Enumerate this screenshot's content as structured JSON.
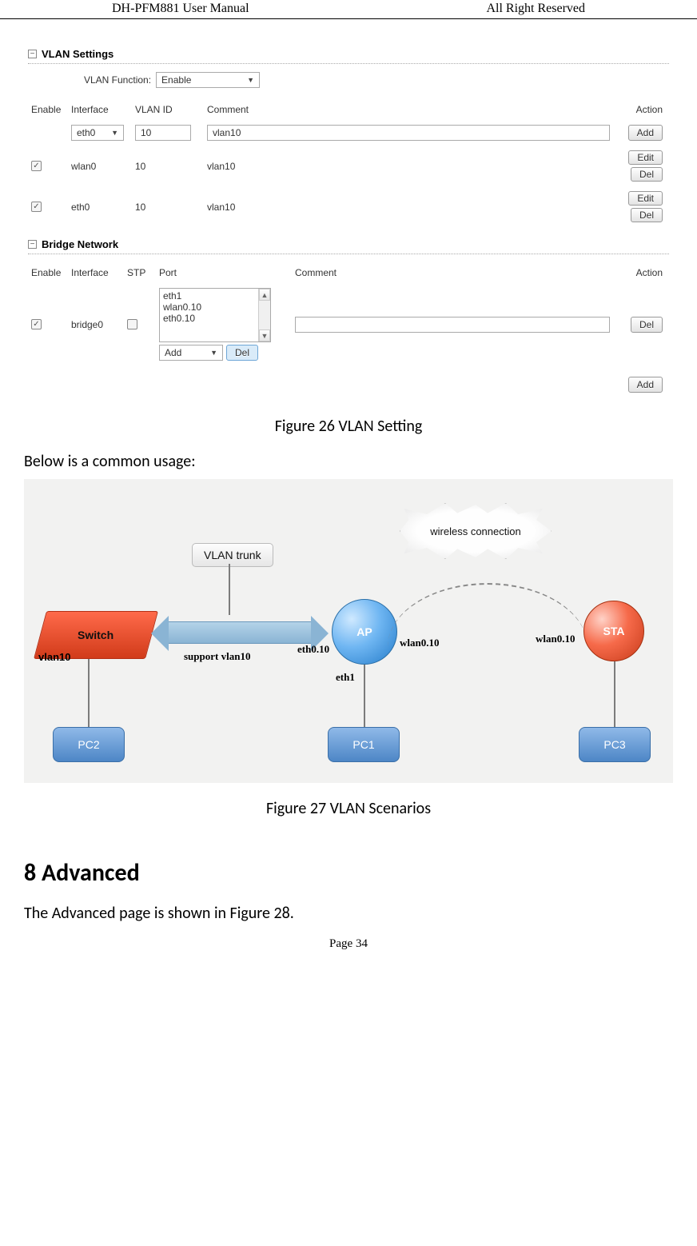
{
  "header": {
    "left": "DH-PFM881 User Manual",
    "right": "All Right Reserved"
  },
  "footer": {
    "page": "Page 34"
  },
  "captions": {
    "fig26": "Figure 26 VLAN Setting",
    "fig27": "Figure 27 VLAN Scenarios"
  },
  "body": {
    "usage_intro": "Below is a common usage:",
    "section_title": "8  Advanced",
    "section_text": "The Advanced page is shown in Figure 28."
  },
  "vlan_settings": {
    "section_title": "VLAN Settings",
    "function_label": "VLAN Function:",
    "function_value": "Enable",
    "columns": {
      "enable": "Enable",
      "interface": "Interface",
      "vlan_id": "VLAN ID",
      "comment": "Comment",
      "action": "Action"
    },
    "new_row": {
      "interface": "eth0",
      "vlan_id": "10",
      "comment": "vlan10",
      "add": "Add"
    },
    "rows": [
      {
        "interface": "wlan0",
        "vlan_id": "10",
        "comment": "vlan10",
        "edit": "Edit",
        "del": "Del"
      },
      {
        "interface": "eth0",
        "vlan_id": "10",
        "comment": "vlan10",
        "edit": "Edit",
        "del": "Del"
      }
    ]
  },
  "bridge_network": {
    "section_title": "Bridge Network",
    "columns": {
      "enable": "Enable",
      "interface": "Interface",
      "stp": "STP",
      "port": "Port",
      "comment": "Comment",
      "action": "Action"
    },
    "row": {
      "interface": "bridge0",
      "ports": [
        "eth1",
        "wlan0.10",
        "eth0.10"
      ],
      "add_select": "Add",
      "del_btn": "Del",
      "action_del": "Del"
    },
    "bottom_add": "Add"
  },
  "diagram": {
    "vlan_trunk": "VLAN trunk",
    "wireless": "wireless connection",
    "switch": "Switch",
    "ap": "AP",
    "sta": "STA",
    "pc1": "PC1",
    "pc2": "PC2",
    "pc3": "PC3",
    "labels": {
      "vlan10": "vlan10",
      "support_vlan10": "support vlan10",
      "eth0_10": "eth0.10",
      "eth1": "eth1",
      "wlan0_10_left": "wlan0.10",
      "wlan0_10_right": "wlan0.10"
    }
  }
}
